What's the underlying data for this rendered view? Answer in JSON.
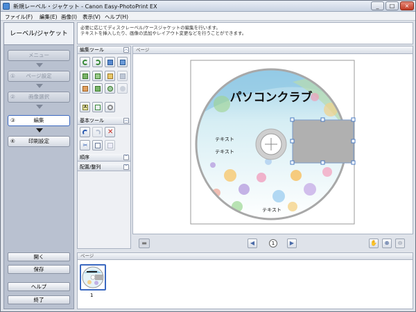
{
  "window": {
    "title": "新規レーベル・ジャケット - Canon Easy-PhotoPrint EX",
    "controls": [
      "_",
      "□",
      "×"
    ]
  },
  "menu": {
    "items": [
      "ファイル(F)",
      "編集(E)",
      "画像(I)",
      "表示(V)",
      "ヘルプ(H)"
    ]
  },
  "sidebar": {
    "title": "レーベル/ジャケット",
    "steps": [
      {
        "num": "",
        "label": "メニュー"
      },
      {
        "num": "①",
        "label": "ページ設定"
      },
      {
        "num": "②",
        "label": "画像選択"
      },
      {
        "num": "③",
        "label": "編集"
      },
      {
        "num": "④",
        "label": "印刷設定"
      }
    ],
    "open_label": "開く",
    "save_label": "保存",
    "help_label": "ヘルプ",
    "exit_label": "終了"
  },
  "description": {
    "line1": "必要に応じてディスクレーベル/ケースジャケットの編集を行います。",
    "line2": "テキストを挿入したり、画像の追加やレイアウト変更などを行うことができます。"
  },
  "tools": {
    "edit_tools_header": "編集ツール",
    "basic_tools_header": "基本ツール",
    "order_header": "順序",
    "arrange_header": "配置/整列"
  },
  "page": {
    "header": "ページ",
    "current_page": "1"
  },
  "label": {
    "title_text": "パソコンクラブ",
    "text1": "テキスト",
    "text2": "テキスト",
    "text3": "テキスト"
  },
  "thumbnails": {
    "header": "ページ",
    "items": [
      {
        "page": "1"
      }
    ]
  },
  "colors": {
    "accent": "#3a68c0",
    "sidebar_bg": "#b9c1d0",
    "delete": "#c8281e"
  },
  "icons": {
    "undo": "undo-icon",
    "redo": "redo-icon",
    "delete": "delete-icon",
    "hand": "hand-icon",
    "zoom_in": "zoom-in-icon",
    "zoom_out": "zoom-out-icon"
  }
}
